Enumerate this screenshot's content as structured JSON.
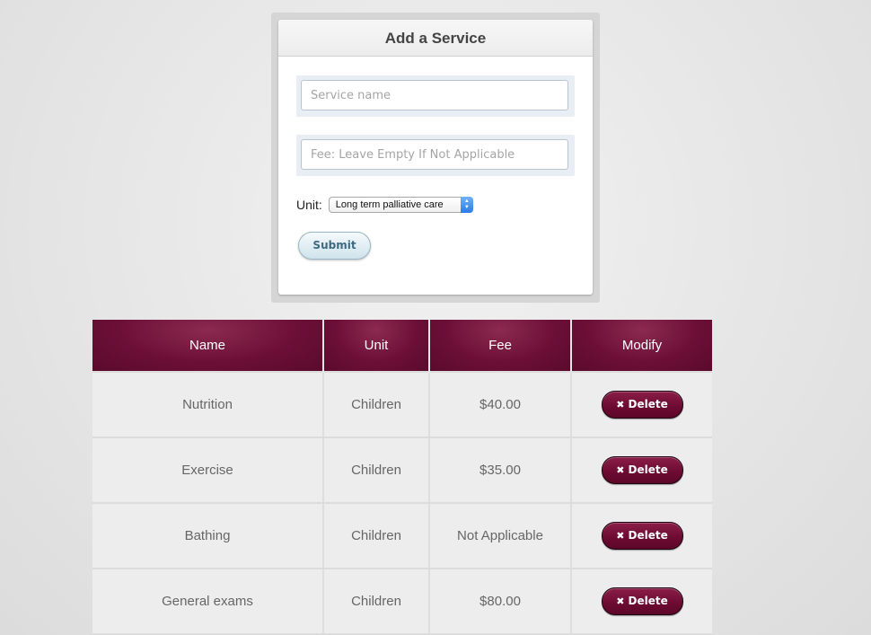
{
  "form": {
    "title": "Add a Service",
    "service_name_placeholder": "Service name",
    "fee_placeholder": "Fee: Leave Empty If Not Applicable",
    "unit_label": "Unit:",
    "unit_selected": "Long term palliative care",
    "submit_label": "Submit"
  },
  "table": {
    "headers": [
      "Name",
      "Unit",
      "Fee",
      "Modify"
    ],
    "delete_label": "Delete",
    "rows": [
      {
        "name": "Nutrition",
        "unit": "Children",
        "fee": "$40.00"
      },
      {
        "name": "Exercise",
        "unit": "Children",
        "fee": "$35.00"
      },
      {
        "name": "Bathing",
        "unit": "Children",
        "fee": "Not Applicable"
      },
      {
        "name": "General exams",
        "unit": "Children",
        "fee": "$80.00"
      }
    ]
  },
  "colors": {
    "accent": "#6c0f37",
    "header_bg": "#6c0f37",
    "row_bg": "#ededed",
    "submit_text": "#3e6a80"
  },
  "icons": {
    "delete": "close-x-icon",
    "select_arrows": "updown-arrows-icon"
  }
}
